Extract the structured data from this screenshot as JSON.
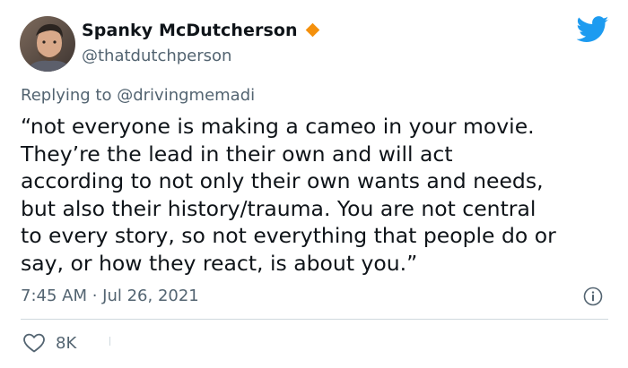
{
  "author": {
    "name": "Spanky McDutcherson",
    "handle": "@thatdutchperson",
    "verified_badge_color": "#f4900c",
    "avatar_icon": "avatar-photo"
  },
  "brand": {
    "logo_icon": "twitter-bird-icon",
    "color": "#1d9bf0"
  },
  "reply": {
    "prefix": "Replying to",
    "mention": "@drivingmemadi"
  },
  "tweet": {
    "lines": [
      "“not everyone is making a cameo in your movie.",
      "They’re the lead in their own and will act",
      "according to not only their own wants and needs,",
      "but also their history/trauma. You are not central",
      "to every story, so not everything that people do or",
      "say, or how they react, is about you.”"
    ],
    "timestamp": "7:45 AM · Jul 26, 2021"
  },
  "actions": {
    "like_count": "8K",
    "like_icon": "heart-icon",
    "info_icon": "info-icon"
  }
}
